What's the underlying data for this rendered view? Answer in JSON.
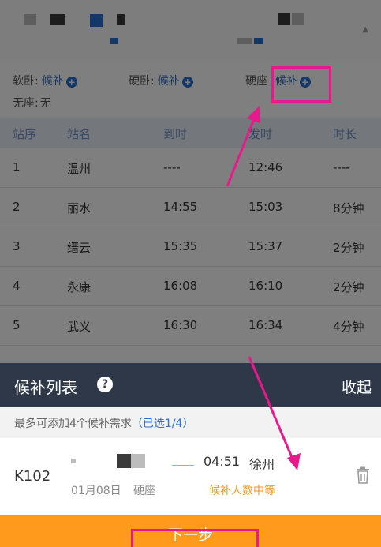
{
  "seats": {
    "soft_sleeper": {
      "label": "软卧:",
      "action": "候补"
    },
    "hard_sleeper": {
      "label": "硬卧:",
      "action": "候补"
    },
    "hard_seat": {
      "label": "硬座",
      "action": "候补"
    },
    "no_seat": {
      "label": "无座:",
      "value": "无"
    }
  },
  "table": {
    "headers": [
      "站序",
      "站名",
      "到时",
      "发时",
      "时长"
    ],
    "rows": [
      {
        "seq": "1",
        "station": "温州",
        "arrive": "----",
        "depart": "12:46",
        "stay": "----"
      },
      {
        "seq": "2",
        "station": "丽水",
        "arrive": "14:55",
        "depart": "15:03",
        "stay": "8分钟"
      },
      {
        "seq": "3",
        "station": "缙云",
        "arrive": "15:35",
        "depart": "15:37",
        "stay": "2分钟"
      },
      {
        "seq": "4",
        "station": "永康",
        "arrive": "16:08",
        "depart": "16:10",
        "stay": "2分钟"
      },
      {
        "seq": "5",
        "station": "武义",
        "arrive": "16:30",
        "depart": "16:34",
        "stay": "4分钟"
      }
    ]
  },
  "sheet": {
    "title": "候补列表",
    "help_icon": "?",
    "collapse": "收起",
    "hint": "最多可添加4个候补需求",
    "hint_selected": "（已选1/4）",
    "entry": {
      "train": "K102",
      "arrive_time": "04:51",
      "arrive_station": "徐州",
      "date": "01月08日",
      "seat_class": "硬座",
      "status": "候补人数中等"
    },
    "next_button": "下一步"
  },
  "colors": {
    "accent_blue": "#2b6fd1",
    "header_dark": "#2f3848",
    "orange": "#ff9a1c",
    "highlight": "#e8198c"
  }
}
